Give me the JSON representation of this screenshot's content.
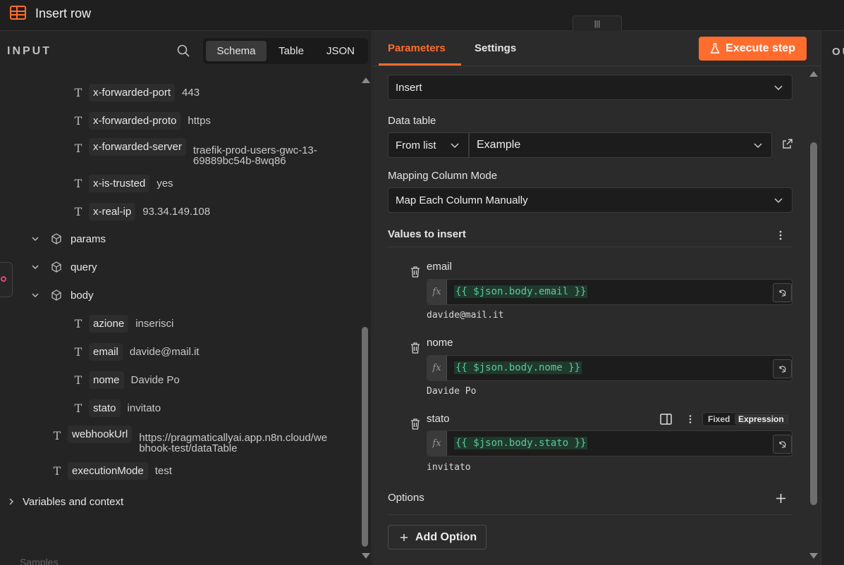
{
  "header": {
    "title": "Insert row",
    "drag_handle": "|||"
  },
  "input_panel": {
    "label": "INPUT",
    "view_tabs": [
      "Schema",
      "Table",
      "JSON"
    ],
    "active_view": "Schema",
    "header_fields": [
      {
        "key": "x-forwarded-port",
        "value": "443"
      },
      {
        "key": "x-forwarded-proto",
        "value": "https"
      },
      {
        "key": "x-forwarded-server",
        "value": "traefik-prod-users-gwc-13-\n69889bc54b-8wq86"
      },
      {
        "key": "x-is-trusted",
        "value": "yes"
      },
      {
        "key": "x-real-ip",
        "value": "93.34.149.108"
      }
    ],
    "objects": [
      "params",
      "query",
      "body"
    ],
    "body_fields": [
      {
        "key": "azione",
        "value": "inserisci"
      },
      {
        "key": "email",
        "value": "davide@mail.it"
      },
      {
        "key": "nome",
        "value": "Davide Po"
      },
      {
        "key": "stato",
        "value": "invitato"
      }
    ],
    "webhook": {
      "key": "webhookUrl",
      "value": "https://pragmaticallyai.app.n8n.cloud/we\nbhook-test/dataTable"
    },
    "execution_mode": {
      "key": "executionMode",
      "value": "test"
    },
    "variables_label": "Variables and context",
    "faded_text": "Samples"
  },
  "params_panel": {
    "tabs": [
      "Parameters",
      "Settings"
    ],
    "active_tab": "Parameters",
    "execute_label": "Execute step",
    "operation_value": "Insert",
    "data_table": {
      "label": "Data table",
      "source_value": "From list",
      "table_value": "Example"
    },
    "mapping": {
      "label": "Mapping Column Mode",
      "value": "Map Each Column Manually"
    },
    "values_label": "Values to insert",
    "fields": [
      {
        "name": "email",
        "expression": "{{ $json.body.email }}",
        "preview": "davide@mail.it"
      },
      {
        "name": "nome",
        "expression": "{{ $json.body.nome }}",
        "preview": "Davide Po"
      },
      {
        "name": "stato",
        "expression": "{{ $json.body.stato }}",
        "preview": "invitato"
      }
    ],
    "mode_toggle": {
      "fixed": "Fixed",
      "expression": "Expression"
    },
    "options_label": "Options",
    "add_option_label": "Add Option",
    "fx_label": "fx"
  },
  "output_panel": {
    "label": "OU"
  },
  "colors": {
    "accent": "#ff6d2e",
    "expression_text": "#5ec79a",
    "background": "#242424"
  }
}
